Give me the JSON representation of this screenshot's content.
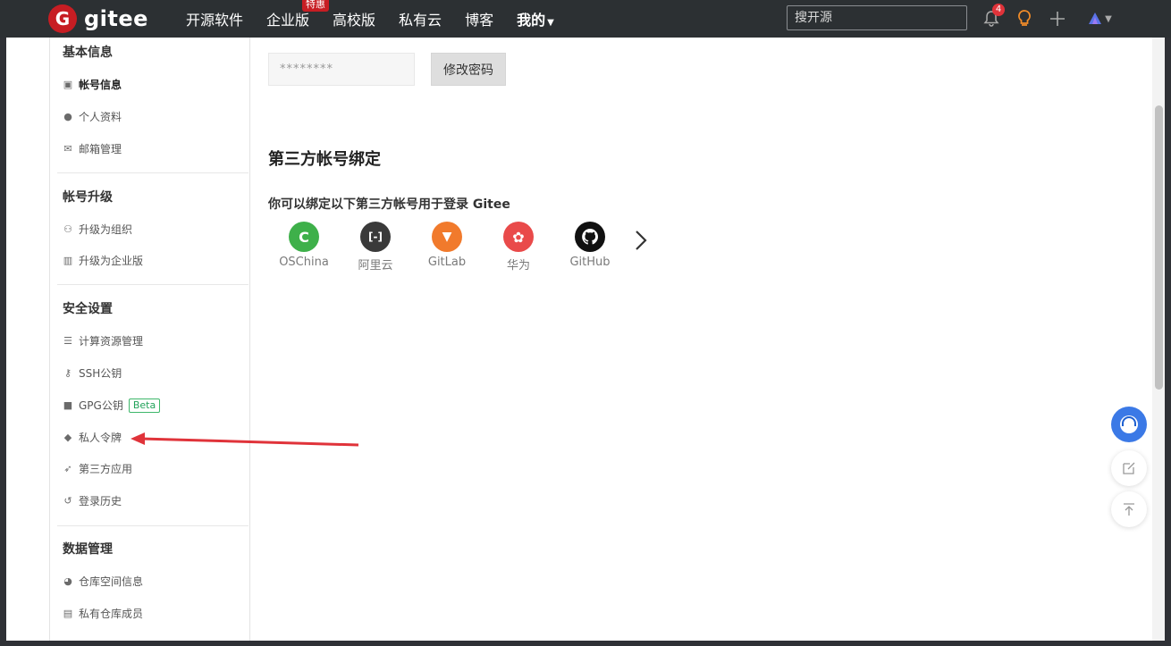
{
  "navbar": {
    "logo_letter": "G",
    "logo_text": "gitee",
    "items": [
      {
        "label": "开源软件"
      },
      {
        "label": "企业版",
        "badge": "特惠"
      },
      {
        "label": "高校版"
      },
      {
        "label": "私有云"
      },
      {
        "label": "博客"
      },
      {
        "label": "我的"
      }
    ],
    "search_placeholder": "搜开源",
    "notification_count": "4"
  },
  "sidebar": {
    "sections": [
      {
        "title": "基本信息",
        "items": [
          {
            "label": "帐号信息",
            "icon": "id-card-icon",
            "active": true
          },
          {
            "label": "个人资料",
            "icon": "user-icon"
          },
          {
            "label": "邮箱管理",
            "icon": "envelope-icon"
          }
        ]
      },
      {
        "title": "帐号升级",
        "items": [
          {
            "label": "升级为组织",
            "icon": "users-icon"
          },
          {
            "label": "升级为企业版",
            "icon": "building-icon"
          }
        ]
      },
      {
        "title": "安全设置",
        "items": [
          {
            "label": "计算资源管理",
            "icon": "server-icon"
          },
          {
            "label": "SSH公钥",
            "icon": "key-icon"
          },
          {
            "label": "GPG公钥",
            "icon": "lock-icon",
            "badge": "Beta"
          },
          {
            "label": "私人令牌",
            "icon": "token-icon"
          },
          {
            "label": "第三方应用",
            "icon": "rocket-icon"
          },
          {
            "label": "登录历史",
            "icon": "history-icon"
          }
        ]
      },
      {
        "title": "数据管理",
        "items": [
          {
            "label": "仓库空间信息",
            "icon": "pie-chart-icon"
          },
          {
            "label": "私有仓库成员",
            "icon": "contact-icon"
          }
        ]
      }
    ]
  },
  "main": {
    "password_mask": "********",
    "change_password_label": "修改密码",
    "bind_heading": "第三方帐号绑定",
    "bind_subheading": "你可以绑定以下第三方帐号用于登录 Gitee",
    "providers": [
      {
        "name": "OSChina",
        "color": "#3eb04a",
        "glyph": "C"
      },
      {
        "name": "阿里云",
        "color": "#3a3a3a",
        "glyph": "[-]"
      },
      {
        "name": "GitLab",
        "color": "#f17a2c",
        "glyph": "▼"
      },
      {
        "name": "华为",
        "color": "#e94a4a",
        "glyph": "✿"
      },
      {
        "name": "GitHub",
        "color": "#111111",
        "glyph": "●"
      }
    ]
  },
  "colors": {
    "brand": "#c71d23",
    "navbar": "#2c3033",
    "annotation_arrow": "#e0333a"
  }
}
